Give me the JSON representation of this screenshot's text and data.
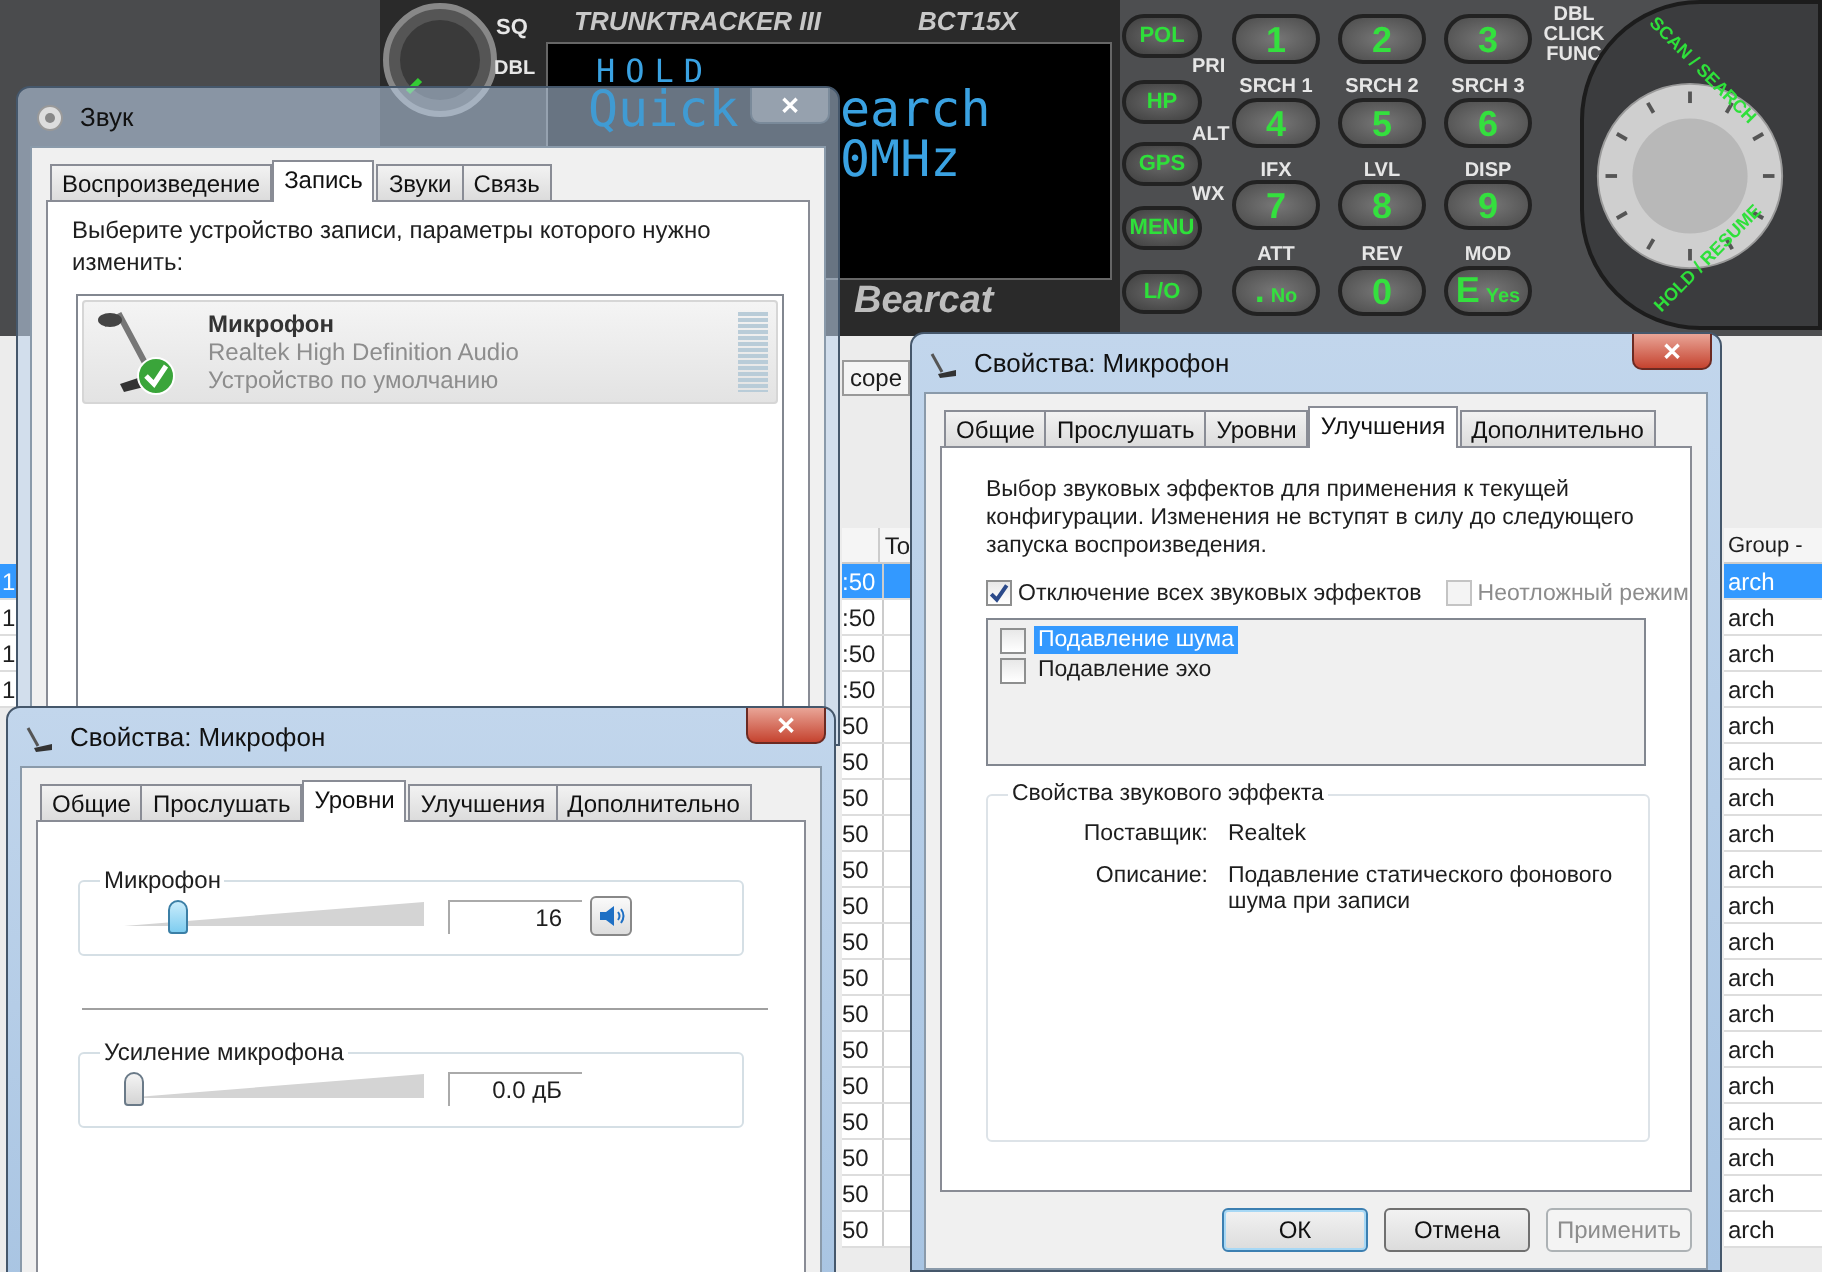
{
  "scanner": {
    "series": "TRUNKTRACKER III",
    "model": "BCT15X",
    "brand": "Bearcat",
    "display_lines": [
      "HOLD",
      "Quick",
      "earch",
      "0MHz"
    ],
    "knob_labels": [
      "SQ",
      "DBL"
    ],
    "side_buttons": [
      "POL",
      "HP",
      "GPS",
      "MENU",
      "L/O"
    ],
    "row_labels": [
      "PRI",
      "ALT",
      "WX"
    ],
    "keys": [
      {
        "label": "1"
      },
      {
        "label": "2"
      },
      {
        "label": "3"
      },
      {
        "label": "4"
      },
      {
        "label": "5"
      },
      {
        "label": "6"
      },
      {
        "label": "7"
      },
      {
        "label": "8"
      },
      {
        "label": "9"
      },
      {
        "label": ".",
        "hint": "No"
      },
      {
        "label": "0"
      },
      {
        "label": "E",
        "hint": "Yes"
      }
    ],
    "key_captions": [
      "SRCH 1",
      "SRCH 2",
      "SRCH 3",
      "IFX",
      "LVL",
      "DISP",
      "ATT",
      "REV",
      "MOD"
    ],
    "func_label": "DBL CLICK FUNC",
    "arc_labels": [
      "SCAN / SEARCH",
      "HOLD / RESUME"
    ]
  },
  "background_app": {
    "tab": "cope",
    "columns": [
      "To",
      "Group -"
    ],
    "rows": [
      {
        "column_1": "1",
        "column_2": ":50",
        "column_4": "arch",
        "selected": true
      },
      {
        "column_1": "1",
        "column_2": ":50",
        "column_4": "arch",
        "selected": false
      },
      {
        "column_1": "1",
        "column_2": ":50",
        "column_4": "arch",
        "selected": false
      },
      {
        "column_1": "1",
        "column_2": ":50",
        "column_4": "arch",
        "selected": false
      },
      {
        "column_2": "50",
        "column_4": "arch",
        "selected": false
      },
      {
        "column_2": "50",
        "column_4": "arch",
        "selected": false
      },
      {
        "column_2": "50",
        "column_4": "arch",
        "selected": false
      },
      {
        "column_2": "50",
        "column_4": "arch",
        "selected": false
      },
      {
        "column_2": "50",
        "column_4": "arch",
        "selected": false
      },
      {
        "column_2": "50",
        "column_4": "arch",
        "selected": false
      },
      {
        "column_2": "50",
        "column_4": "arch",
        "selected": false
      },
      {
        "column_2": "50",
        "column_4": "arch",
        "selected": false
      },
      {
        "column_2": "50",
        "column_4": "arch",
        "selected": false
      },
      {
        "column_2": "50",
        "column_4": "arch",
        "selected": false
      },
      {
        "column_2": "50",
        "column_4": "arch",
        "selected": false
      },
      {
        "column_2": "50",
        "column_4": "arch",
        "selected": false
      },
      {
        "column_2": "50",
        "column_4": "arch",
        "selected": false
      },
      {
        "column_2": "50",
        "column_4": "arch",
        "selected": false
      },
      {
        "column_2": "50",
        "column_4": "arch",
        "selected": false
      }
    ]
  },
  "sound_window": {
    "title": "Звук",
    "close": "✕",
    "tabs": [
      {
        "label": "Воспроизведение",
        "selected": false
      },
      {
        "label": "Запись",
        "selected": true
      },
      {
        "label": "Звуки",
        "selected": false
      },
      {
        "label": "Связь",
        "selected": false
      }
    ],
    "instruction": "Выберите устройство записи, параметры которого нужно изменить:",
    "devices": [
      {
        "name": "Микрофон",
        "driver": "Realtek High Definition Audio",
        "status": "Устройство по умолчанию",
        "default": true,
        "selected": true,
        "level": 0
      }
    ]
  },
  "levels_window": {
    "title": "Свойства: Микрофон",
    "close": "✕",
    "tabs": [
      {
        "label": "Общие",
        "selected": false
      },
      {
        "label": "Прослушать",
        "selected": false
      },
      {
        "label": "Уровни",
        "selected": true
      },
      {
        "label": "Улучшения",
        "selected": false
      },
      {
        "label": "Дополнительно",
        "selected": false
      }
    ],
    "controls": [
      {
        "label": "Микрофон",
        "value": "16",
        "level": 0.16,
        "muted": false
      },
      {
        "label": "Усиление микрофона",
        "value": "0.0 дБ",
        "level": 0
      }
    ]
  },
  "enhancements_window": {
    "title": "Свойства: Микрофон",
    "close": "✕",
    "tabs": [
      {
        "label": "Общие",
        "selected": false
      },
      {
        "label": "Прослушать",
        "selected": false
      },
      {
        "label": "Уровни",
        "selected": false
      },
      {
        "label": "Улучшения",
        "selected": true
      },
      {
        "label": "Дополнительно",
        "selected": false
      }
    ],
    "description": "Выбор звуковых эффектов для применения к текущей конфигурации. Изменения не вступят в силу до следующего запуска воспроизведения.",
    "options": [
      {
        "label": "Отключение всех звуковых эффектов",
        "checked": true,
        "disabled": false
      },
      {
        "label": "Неотложный режим",
        "checked": false,
        "disabled": true
      }
    ],
    "effects": [
      {
        "label": "Подавление шума",
        "checked": false,
        "selected": true
      },
      {
        "label": "Подавление эхо",
        "checked": false,
        "selected": false
      }
    ],
    "properties_title": "Свойства звукового эффекта",
    "properties": [
      {
        "label": "Поставщик:",
        "value": "Realtek"
      },
      {
        "label": "Описание:",
        "value": "Подавление статического фонового шума при записи"
      }
    ],
    "buttons": [
      {
        "label": "ОК",
        "default": true,
        "disabled": false
      },
      {
        "label": "Отмена",
        "default": false,
        "disabled": false
      },
      {
        "label": "Применить",
        "default": false,
        "disabled": true
      }
    ]
  }
}
